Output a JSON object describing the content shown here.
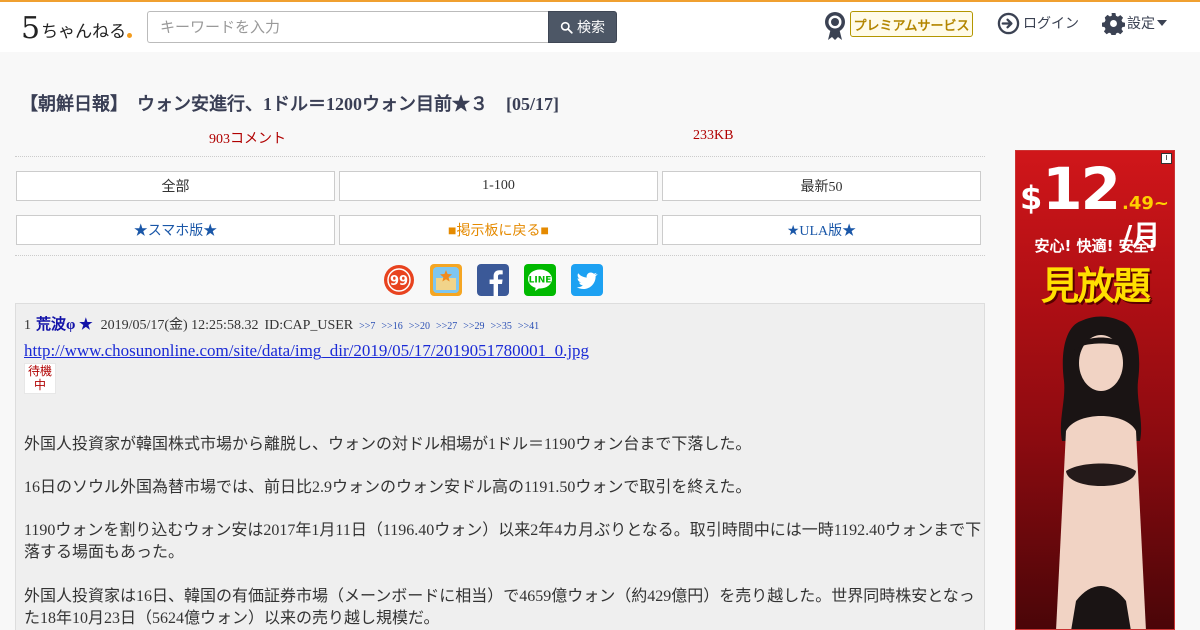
{
  "header": {
    "logo_number": "5",
    "logo_text": "ちゃんねる",
    "search_placeholder": "キーワードを入力",
    "search_label": "検索",
    "premium_label": "プレミアムサービス",
    "login_label": "ログイン",
    "settings_label": "設定"
  },
  "thread": {
    "title": "【朝鮮日報】　ウォン安進行、1ドル＝1200ウォン目前★３　[05/17]",
    "comment_count": "903コメント",
    "size": "233KB"
  },
  "nav": {
    "row1": [
      "全部",
      "1-100",
      "最新50"
    ],
    "row2": [
      "★スマホ版★",
      "■掲示板に戻る■",
      "★ULA版★"
    ]
  },
  "share": [
    {
      "name": "99-icon",
      "color": "#e8431f"
    },
    {
      "name": "hatena-icon",
      "color": "#f5a623"
    },
    {
      "name": "facebook-icon",
      "color": "#3b5998"
    },
    {
      "name": "line-icon",
      "color": "#00b900"
    },
    {
      "name": "twitter-icon",
      "color": "#1da1f2"
    }
  ],
  "post": {
    "number": "1",
    "name": "荒波φ ★",
    "date": "2019/05/17(金) 12:25:58.32",
    "id": "ID:CAP_USER",
    "replies": [
      ">>7",
      ">>16",
      ">>20",
      ">>27",
      ">>29",
      ">>35",
      ">>41"
    ],
    "link": "http://www.chosunonline.com/site/data/img_dir/2019/05/17/2019051780001_0.jpg",
    "wait_badge": "待機中",
    "paragraphs": [
      "外国人投資家が韓国株式市場から離脱し、ウォンの対ドル相場が1ドル＝1190ウォン台まで下落した。",
      "16日のソウル外国為替市場では、前日比2.9ウォンのウォン安ドル高の1191.50ウォンで取引を終えた。",
      "1190ウォンを割り込むウォン安は2017年1月11日（1196.40ウォン）以来2年4カ月ぶりとなる。取引時間中には一時1192.40ウォンまで下落する場面もあった。",
      "外国人投資家は16日、韓国の有価証券市場（メーンボードに相当）で4659億ウォン（約429億円）を売り越した。世界同時株安となった18年10月23日（5624億ウォン）以来の売り越し規模だ。"
    ]
  },
  "ad": {
    "info": "i",
    "currency": "$",
    "price_whole": "12",
    "price_cents": ".49~",
    "per_month": "/月",
    "tagline": "安心! 快適! 安全!",
    "headline": "見放題"
  }
}
